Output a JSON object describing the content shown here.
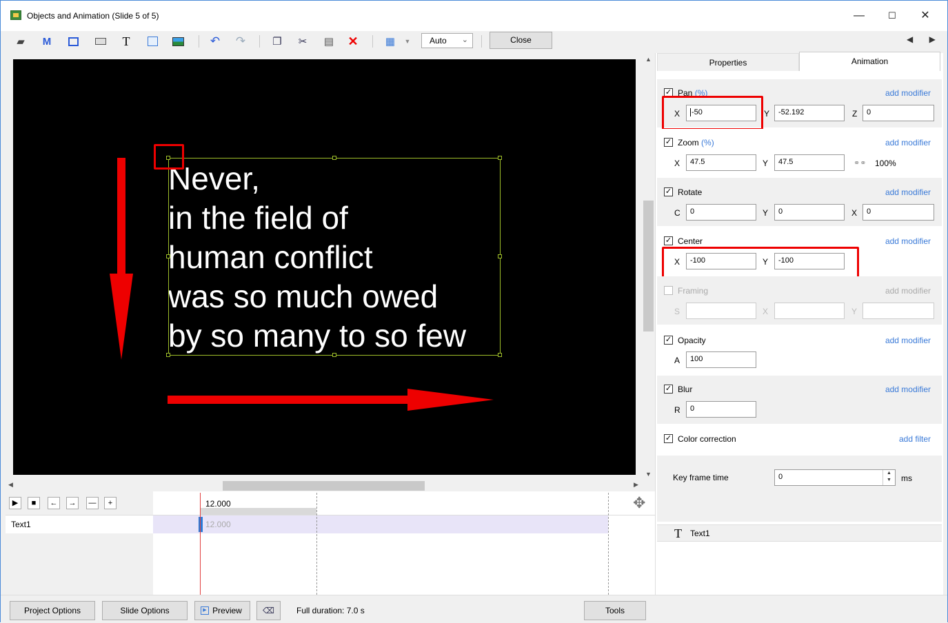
{
  "window": {
    "title": "Objects and Animation (Slide 5 of 5)",
    "minimize": "—",
    "maximize": "☐",
    "close": "✕"
  },
  "toolbar": {
    "m_label": "M",
    "t_label": "T",
    "auto_value": "Auto",
    "close_label": "Close",
    "nav": "◀ ▶"
  },
  "canvas": {
    "lines": [
      "Never,",
      "in the field of",
      "human conflict",
      "was so much owed",
      "by so many to so few"
    ]
  },
  "timeline": {
    "time_header": "12.000",
    "row_label": "Text1",
    "row_time": "12.000",
    "controls": [
      "▶",
      "■",
      "←",
      "→",
      "—",
      "+"
    ]
  },
  "bottom": {
    "project_options": "Project Options",
    "slide_options": "Slide Options",
    "preview": "Preview",
    "full_duration": "Full duration: 7.0 s",
    "tools": "Tools"
  },
  "panel": {
    "tabs": {
      "properties": "Properties",
      "animation": "Animation"
    },
    "add_modifier": "add modifier",
    "add_filter": "add filter",
    "pan": {
      "label": "Pan",
      "unit": "(%)",
      "x_label": "X",
      "x": "-50",
      "y_label": "Y",
      "y": "-52.192",
      "z_label": "Z",
      "z": "0"
    },
    "zoom": {
      "label": "Zoom",
      "unit": "(%)",
      "x_label": "X",
      "x": "47.5",
      "y_label": "Y",
      "y": "47.5",
      "pct": "100%"
    },
    "rotate": {
      "label": "Rotate",
      "c_label": "C",
      "c": "0",
      "y_label": "Y",
      "y": "0",
      "x_label": "X",
      "x": "0"
    },
    "center": {
      "label": "Center",
      "x_label": "X",
      "x": "-100",
      "y_label": "Y",
      "y": "-100"
    },
    "framing": {
      "label": "Framing",
      "s_label": "S",
      "x_label": "X",
      "y_label": "Y"
    },
    "opacity": {
      "label": "Opacity",
      "a_label": "A",
      "a": "100"
    },
    "blur": {
      "label": "Blur",
      "r_label": "R",
      "r": "0"
    },
    "color_correction": {
      "label": "Color correction"
    },
    "keyframe": {
      "label": "Key frame time",
      "value": "0",
      "unit": "ms"
    },
    "object": {
      "icon": "T",
      "label": "Text1"
    }
  },
  "colors": {
    "accent_link": "#3a7ad8",
    "highlight_red": "#e00000",
    "selection": "#9fbf2a"
  }
}
